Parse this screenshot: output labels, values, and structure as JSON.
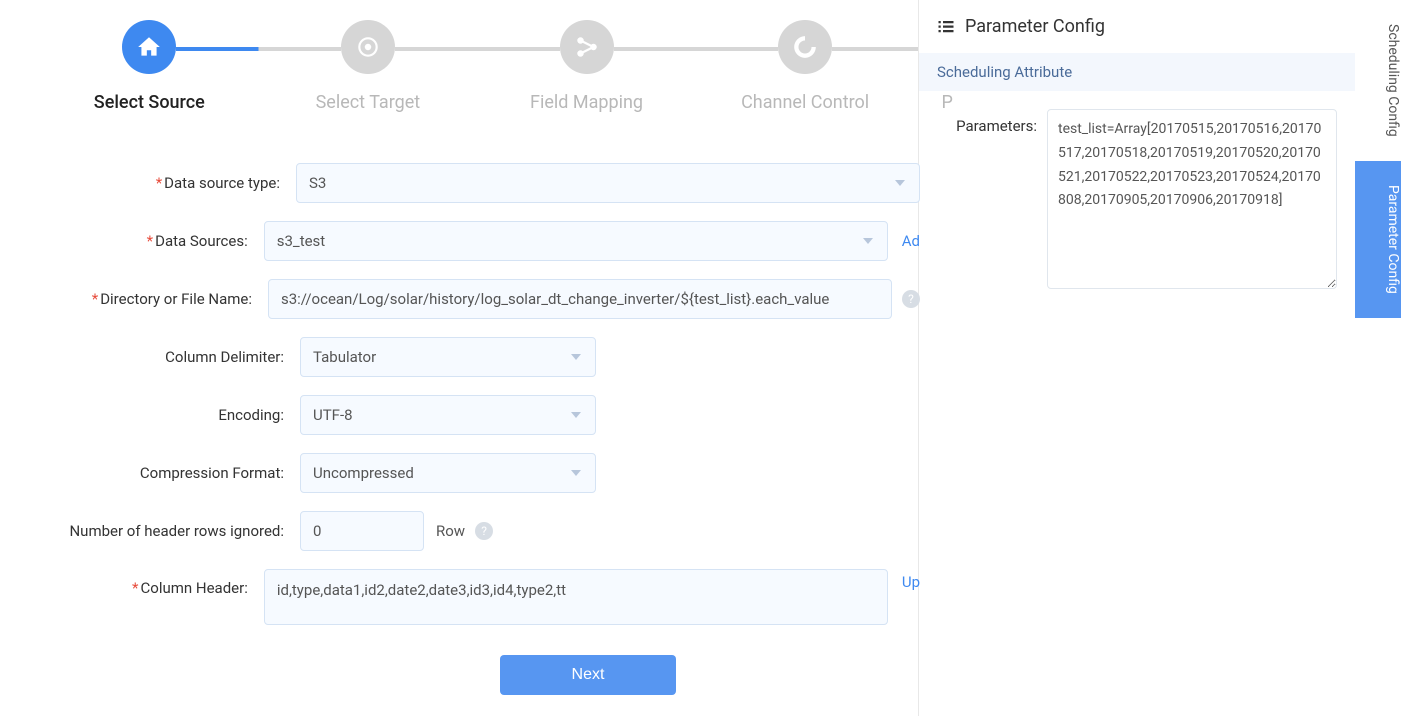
{
  "steps": [
    {
      "label": "Select Source",
      "active": true,
      "icon": "house"
    },
    {
      "label": "Select Target",
      "active": false,
      "icon": "target"
    },
    {
      "label": "Field Mapping",
      "active": false,
      "icon": "mapping"
    },
    {
      "label": "Channel Control",
      "active": false,
      "icon": "channel"
    },
    {
      "label": "P",
      "active": false,
      "icon": "more"
    }
  ],
  "form": {
    "data_source_type": {
      "label": "Data source type:",
      "value": "S3"
    },
    "data_sources": {
      "label": "Data Sources:",
      "value": "s3_test",
      "link": "Ad"
    },
    "directory": {
      "label": "Directory or File Name:",
      "value": "s3://ocean/Log/solar/history/log_solar_dt_change_inverter/${test_list}.each_value"
    },
    "col_delim": {
      "label": "Column Delimiter:",
      "value": "Tabulator"
    },
    "encoding": {
      "label": "Encoding:",
      "value": "UTF-8"
    },
    "compression": {
      "label": "Compression Format:",
      "value": "Uncompressed"
    },
    "header_rows": {
      "label": "Number of header rows ignored:",
      "value": "0",
      "unit": "Row"
    },
    "col_header": {
      "label": "Column Header:",
      "value": "id,type,data1,id2,date2,date3,id3,id4,type2,tt",
      "link": "Up"
    },
    "next_btn": "Next"
  },
  "param_panel": {
    "title": "Parameter Config",
    "section": "Scheduling Attribute",
    "params_label": "Parameters:",
    "params_value": "test_list=Array[20170515,20170516,20170517,20170518,20170519,20170520,20170521,20170522,20170523,20170524,20170808,20170905,20170906,20170918]"
  },
  "vtabs": [
    {
      "label": "Scheduling Config",
      "active": false
    },
    {
      "label": "Parameter Config",
      "active": true
    }
  ]
}
